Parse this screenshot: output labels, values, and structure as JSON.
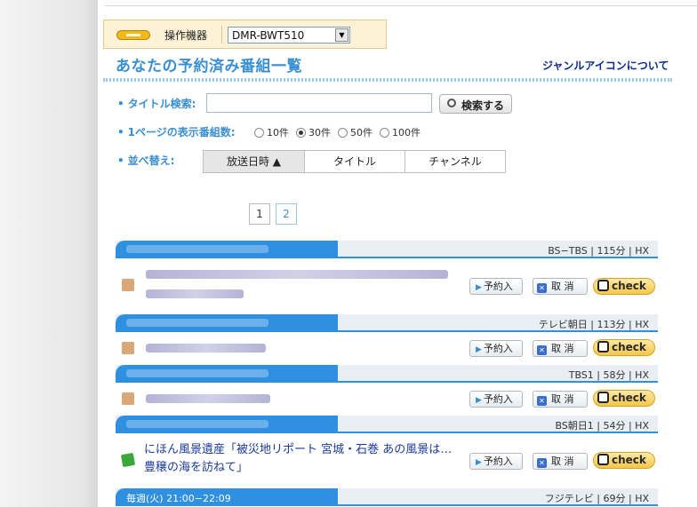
{
  "device": {
    "label": "操作機器",
    "selected": "DMR-BWT510"
  },
  "page_title": "あなたの予約済み番組一覧",
  "genre_link": "ジャンルアイコンについて",
  "search": {
    "label": "タイトル検索:",
    "button": "検索する",
    "value": ""
  },
  "per_page": {
    "label": "1ページの表示番組数:",
    "options": [
      "10件",
      "30件",
      "50件",
      "100件"
    ],
    "selected": "30件"
  },
  "sort": {
    "label": "並べ替え:",
    "tabs": [
      "放送日時 ▲",
      "タイトル",
      "チャンネル"
    ],
    "active": "放送日時 ▲"
  },
  "pager": {
    "pages": [
      "1",
      "2"
    ],
    "current": "1"
  },
  "buttons": {
    "reserve": "予約入",
    "cancel": "取 消",
    "check": "check"
  },
  "programs": [
    {
      "meta": "BS−TBS | 115分 | HX",
      "genre_icon": "person-icon"
    },
    {
      "meta": "テレビ朝日 | 113分 | HX",
      "genre_icon": "person-icon"
    },
    {
      "meta": "TBS1 | 58分 | HX",
      "genre_icon": "person-icon"
    },
    {
      "meta": "BS朝日1 | 54分 | HX",
      "genre_icon": "book-icon",
      "title": "にほん風景遺産「被災地リポート 宮城・石巻 あの風景は…豊穣の海を訪ねて」"
    },
    {
      "meta": "フジテレビ | 69分 | HX",
      "header_text": "毎週(火) 21:00−22:09"
    }
  ]
}
